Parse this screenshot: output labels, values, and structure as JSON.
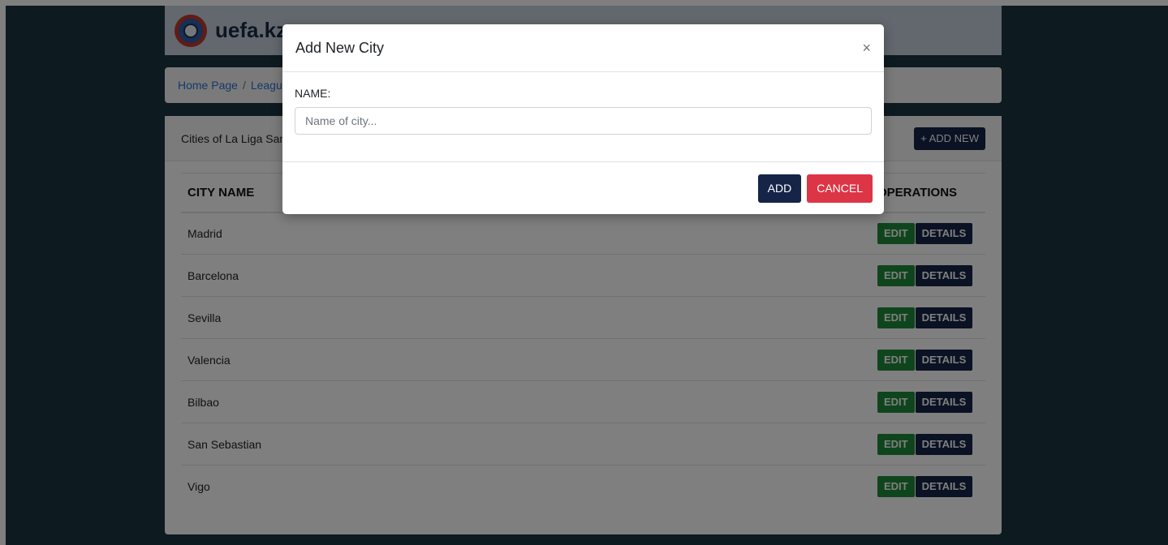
{
  "header": {
    "site_title": "uefa.kz"
  },
  "breadcrumb": {
    "home": "Home Page",
    "separator": "/",
    "current": "Leagues"
  },
  "card": {
    "title": "Cities of La Liga Santander",
    "add_new_label": "+ ADD NEW",
    "columns": {
      "name": "CITY NAME",
      "operations": "OPERATIONS"
    },
    "rows": [
      {
        "name": "Madrid"
      },
      {
        "name": "Barcelona"
      },
      {
        "name": "Sevilla"
      },
      {
        "name": "Valencia"
      },
      {
        "name": "Bilbao"
      },
      {
        "name": "San Sebastian"
      },
      {
        "name": "Vigo"
      }
    ],
    "edit_label": "EDIT",
    "details_label": "DETAILS"
  },
  "modal": {
    "title": "Add New City",
    "close_symbol": "×",
    "name_label": "NAME:",
    "name_placeholder": "Name of city...",
    "name_value": "",
    "add_label": "ADD",
    "cancel_label": "CANCEL"
  },
  "colors": {
    "page_bg": "#1b3440",
    "primary": "#152447",
    "success": "#1f8a3a",
    "danger": "#dc3545",
    "link": "#2f6fd6"
  }
}
